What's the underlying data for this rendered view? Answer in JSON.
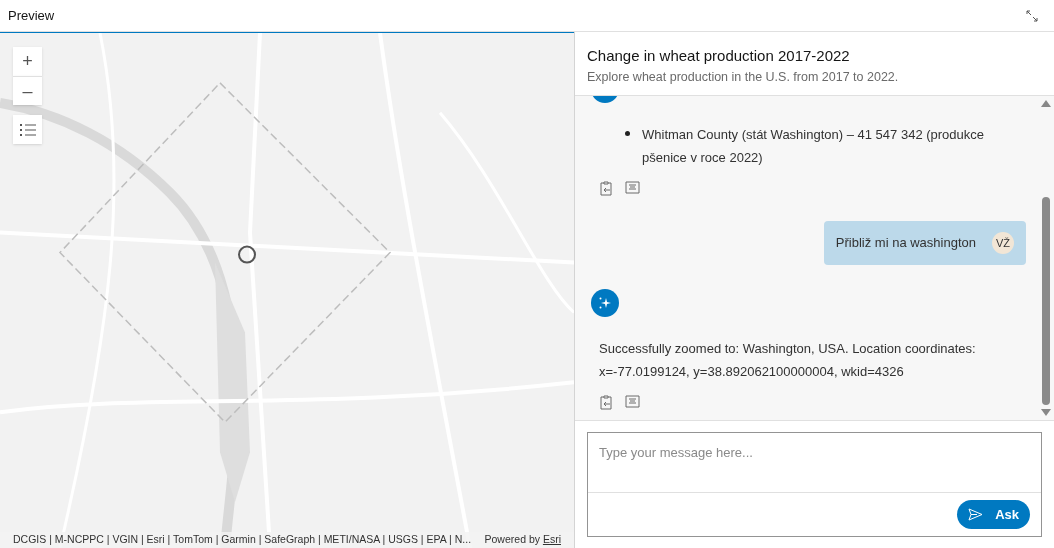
{
  "header": {
    "title": "Preview"
  },
  "map": {
    "controls": [
      {
        "kind": "zoom-in",
        "label": "+"
      },
      {
        "kind": "zoom-out",
        "label": "–"
      },
      {
        "kind": "legend"
      }
    ],
    "attribution": "DCGIS | M-NCPPC | VGIN | Esri | TomTom | Garmin | SafeGraph | METI/NASA | USGS | EPA | N...",
    "powered_by": "Powered by",
    "powered_link": "Esri"
  },
  "panel": {
    "title": "Change in wheat production 2017-2022",
    "subtitle": "Explore wheat production in the U.S. from 2017 to 2022."
  },
  "messages": [
    {
      "kind": "assistant",
      "bullets": [
        "Whitman County (stát Washington) – 41 547 342 (produkce pšenice v roce 2022)"
      ]
    },
    {
      "kind": "user",
      "text": "Přibliž mi na washington",
      "initials": "VŽ"
    },
    {
      "kind": "assistant",
      "text": "Successfully zoomed to: Washington, USA. Location coordinates: x=-77.0199124, y=38.892062100000004, wkid=4326"
    }
  ],
  "input": {
    "placeholder": "Type your message here...",
    "button": "Ask"
  }
}
